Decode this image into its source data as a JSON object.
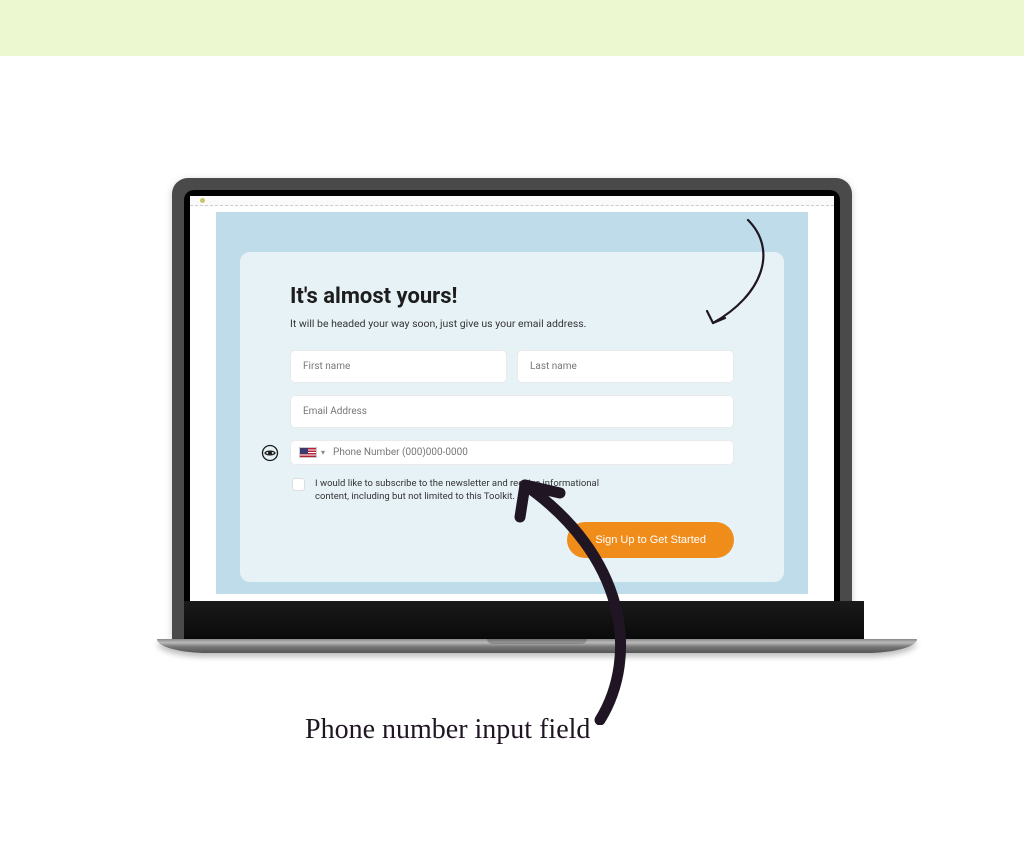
{
  "form": {
    "title": "It's almost yours!",
    "subtitle": "It will be headed your way soon, just give us your email address.",
    "first_name_placeholder": "First name",
    "last_name_placeholder": "Last name",
    "email_placeholder": "Email Address",
    "phone_placeholder": "Phone Number (000)000-0000",
    "subscribe_label": "I would like to subscribe to the newsletter and receive informational content, including but not limited to this Toolkit.",
    "submit_label": "Sign Up to Get Started"
  },
  "annotation": {
    "label": "Phone number input field"
  },
  "colors": {
    "banner": "#ecf9d0",
    "page_bg": "#bfdcea",
    "card_bg": "#e7f2f7",
    "button": "#f08c1a",
    "annotation": "#201623"
  }
}
